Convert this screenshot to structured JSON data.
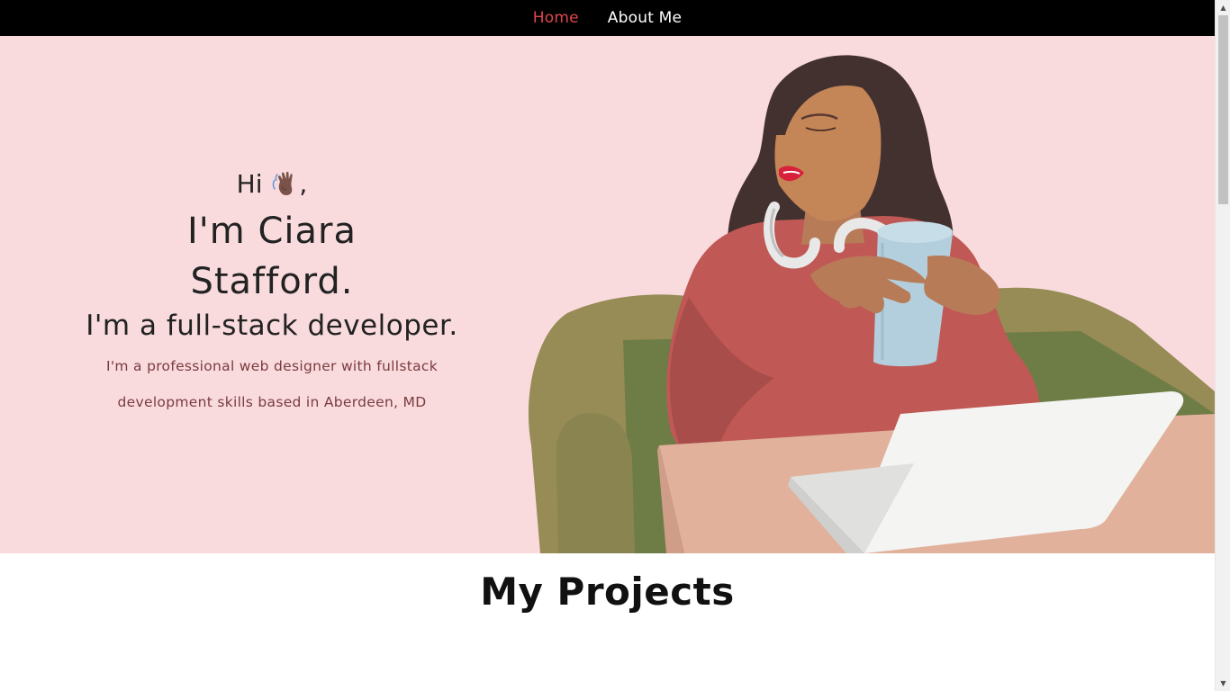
{
  "nav": {
    "items": [
      {
        "label": "Home",
        "active": true
      },
      {
        "label": "About Me",
        "active": false
      }
    ],
    "active_color": "#e0454b"
  },
  "hero": {
    "greeting": "Hi",
    "greeting_suffix": ",",
    "wave_icon": "waving-hand-icon",
    "name_line1": "I'm Ciara",
    "name_line2": "Stafford.",
    "role": "I'm a full-stack developer.",
    "description": "I'm a professional web designer with fullstack development skills based in Aberdeen, MD",
    "background_color": "#f9dbde"
  },
  "projects": {
    "title": "My Projects"
  }
}
